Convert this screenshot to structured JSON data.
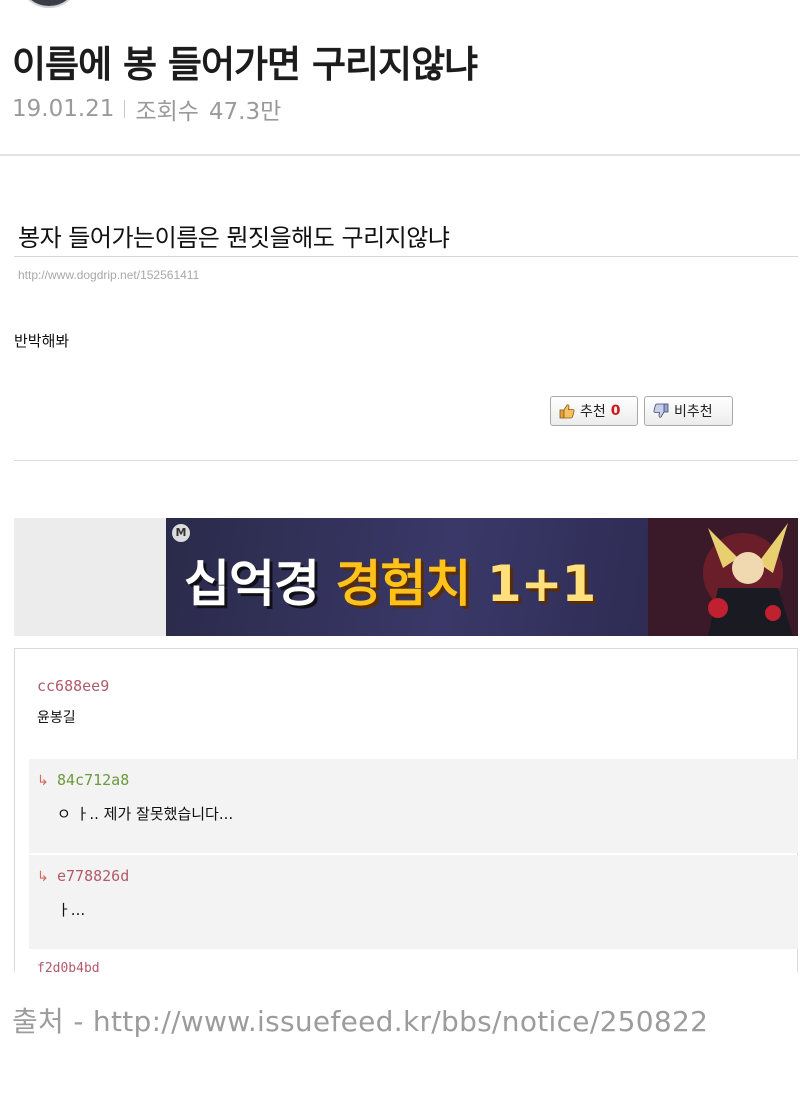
{
  "post": {
    "title": "이름에 봉 들어가면 구리지않냐",
    "date": "19.01.21",
    "views_label": "조회수",
    "views": "47.3만"
  },
  "embed": {
    "title": "봉자 들어가는이름은 뭔짓을해도 구리지않냐",
    "url": "http://www.dogdrip.net/152561411",
    "body": "반박해봐",
    "vote_up_label": "추천",
    "vote_up_count": "0",
    "vote_down_label": "비추천",
    "ad_logo": "M",
    "ad_text_1": "십억경",
    "ad_text_2": "경험치",
    "ad_text_3": "1+1",
    "comments": [
      {
        "author": "cc688ee9",
        "text": "윤봉길"
      },
      {
        "author": "84c712a8",
        "text": "ㅇ ㅏ.. 제가 잘못했습니다...",
        "reply": true
      },
      {
        "author": "e778826d",
        "text": "ㅏ...",
        "reply": true
      },
      {
        "author": "f2d0b4bd"
      }
    ],
    "reply_arrow": "↳"
  },
  "source": "출처 - http://www.issuefeed.kr/bbs/notice/250822",
  "colors": {
    "vote_count": "#d01818",
    "author_green": "#6a9a3a",
    "author_red": "#b25a6a",
    "ad_yellow": "#ffc21a"
  }
}
